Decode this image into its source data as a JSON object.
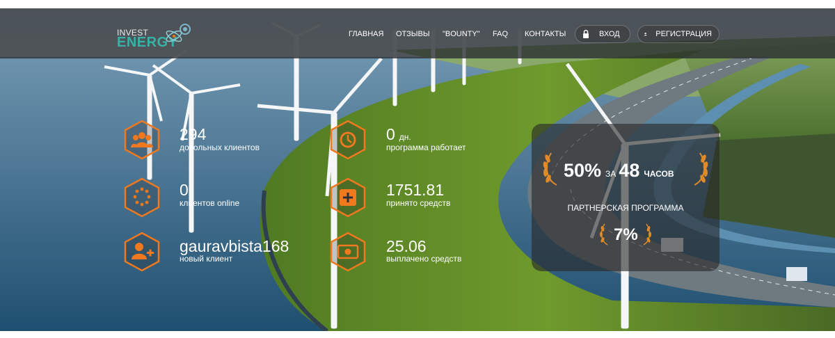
{
  "logo": {
    "line1": "INVEST",
    "line2": "ENERGY",
    "icon": "atom-gear-logo-icon"
  },
  "nav": {
    "items": [
      {
        "label": "ГЛАВНАЯ"
      },
      {
        "label": "ОТЗЫВЫ"
      },
      {
        "label": "\"BOUNTY\""
      },
      {
        "label": "FAQ"
      },
      {
        "label": "КОНТАКТЫ"
      }
    ],
    "login": {
      "label": "ВХОД",
      "icon": "lock-icon"
    },
    "register": {
      "label": "РЕГИСТРАЦИЯ",
      "icon": "user-icon"
    }
  },
  "stats": [
    {
      "value": "294",
      "unit": "",
      "label": "довольных клиентов",
      "icon": "users-icon"
    },
    {
      "value": "0",
      "unit": "",
      "label": "клиентов online",
      "icon": "dots-circle-icon"
    },
    {
      "value": "gauravbista168",
      "unit": "",
      "label": "новый клиент",
      "icon": "add-user-icon"
    },
    {
      "value": "0",
      "unit": "дн.",
      "label": "программа работает",
      "icon": "clock-icon"
    },
    {
      "value": "1751.81",
      "unit": "",
      "label": "принято средств",
      "icon": "plus-box-icon"
    },
    {
      "value": "25.06",
      "unit": "",
      "label": "выплачено средств",
      "icon": "money-icon"
    }
  ],
  "promo": {
    "rate": "50%",
    "for": "за",
    "hours_value": "48",
    "hours_label": "часов",
    "partner_label": "ПАРТНЕРСКАЯ ПРОГРАММА",
    "ref_percent": "7%",
    "icon": "laurel-wreath-icon"
  },
  "colors": {
    "accent": "#f0781e",
    "teal": "#36b2a8",
    "navbar": "#2c3034"
  }
}
